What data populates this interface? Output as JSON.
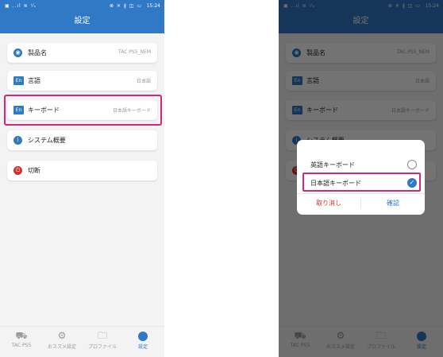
{
  "status_bar": {
    "left_icons": "▣ ..ıl ≋ ⁱ⁄ₛ",
    "right_icons": "⊗ ✕ ∦ ◫ ▭",
    "time": "15:24"
  },
  "header": {
    "title": "設定"
  },
  "settings": [
    {
      "icon": "◉",
      "label": "製品名",
      "value": "TAC PS5_NEM",
      "icon_color": "#2f79c6"
    },
    {
      "icon": "En",
      "label": "言語",
      "value": "日本語",
      "icon_color": "#2f79c6"
    },
    {
      "icon": "En",
      "label": "キーボード",
      "value": "日本語キーボード",
      "icon_color": "#2f79c6"
    },
    {
      "icon": "i",
      "label": "システム概要",
      "value": "",
      "icon_color": "#2f79c6"
    },
    {
      "icon": "⏻",
      "label": "切断",
      "value": "",
      "icon_color": "#d32f2f"
    }
  ],
  "tabs": [
    {
      "label": "TAC PS5",
      "icon": "⛟"
    },
    {
      "label": "おススメ設定",
      "icon": "⚙"
    },
    {
      "label": "プロファイル",
      "icon": "🗀"
    },
    {
      "label": "設定",
      "icon": "",
      "active": true
    }
  ],
  "dialog": {
    "options": [
      {
        "label": "英語キーボード",
        "selected": false
      },
      {
        "label": "日本語キーボード",
        "selected": true
      }
    ],
    "cancel": "取り消し",
    "confirm": "確認",
    "check_glyph": "✓"
  },
  "colors": {
    "primary": "#2f79c6",
    "highlight": "#d3287a",
    "danger": "#d32f2f"
  }
}
